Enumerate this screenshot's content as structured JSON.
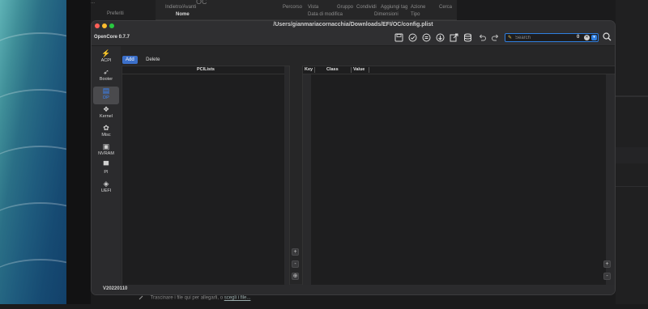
{
  "background_finder": {
    "sidebar_label": "Preferiti",
    "location_title": "OC",
    "toolbar_labels": [
      "Indietro/Avanti",
      "Percorso",
      "Vista",
      "Gruppo",
      "Condividi",
      "Aggiungi tag",
      "Azione",
      "Cerca"
    ],
    "columns": [
      "Nome",
      "Data di modifica",
      "Dimensioni",
      "Tipo"
    ],
    "top_right_fragment": "...",
    "drop_hint": "Trascinare i file qui per allegarli, o",
    "drop_hint_link": "scegli i file..."
  },
  "window": {
    "title": "/Users/gianmariacornacchia/Downloads/EFI/OC/config.plist",
    "app_name": "OpenCore 0.7.7",
    "version": "V20220110"
  },
  "toolbar": {
    "icons": [
      "save-icon",
      "check-icon",
      "info-icon",
      "download-icon",
      "export-icon",
      "database-icon",
      "undo-icon",
      "redo-icon"
    ],
    "search": {
      "placeholder": "Search",
      "count": "0"
    }
  },
  "sidebar": {
    "items": [
      {
        "label": "ACPI",
        "icon": "bolt-icon"
      },
      {
        "label": "Booter",
        "icon": "rocket-icon"
      },
      {
        "label": "DP",
        "icon": "display-icon",
        "active": true
      },
      {
        "label": "Kernel",
        "icon": "kernel-icon"
      },
      {
        "label": "Misc",
        "icon": "misc-icon"
      },
      {
        "label": "NVRAM",
        "icon": "chip-icon"
      },
      {
        "label": "PI",
        "icon": "pi-icon"
      },
      {
        "label": "UEFI",
        "icon": "cube-icon"
      }
    ]
  },
  "content": {
    "tabs": [
      {
        "label": "Add",
        "active": true
      },
      {
        "label": "Delete",
        "active": false
      }
    ],
    "left_panel": {
      "header": "PCILists"
    },
    "right_panel": {
      "columns": [
        "Key",
        "Class",
        "Value"
      ]
    },
    "buttons": {
      "add": "+",
      "remove": "-",
      "move": "⊕"
    }
  },
  "colors": {
    "accent": "#3b6fc9",
    "search_border": "#2f7fe0"
  }
}
